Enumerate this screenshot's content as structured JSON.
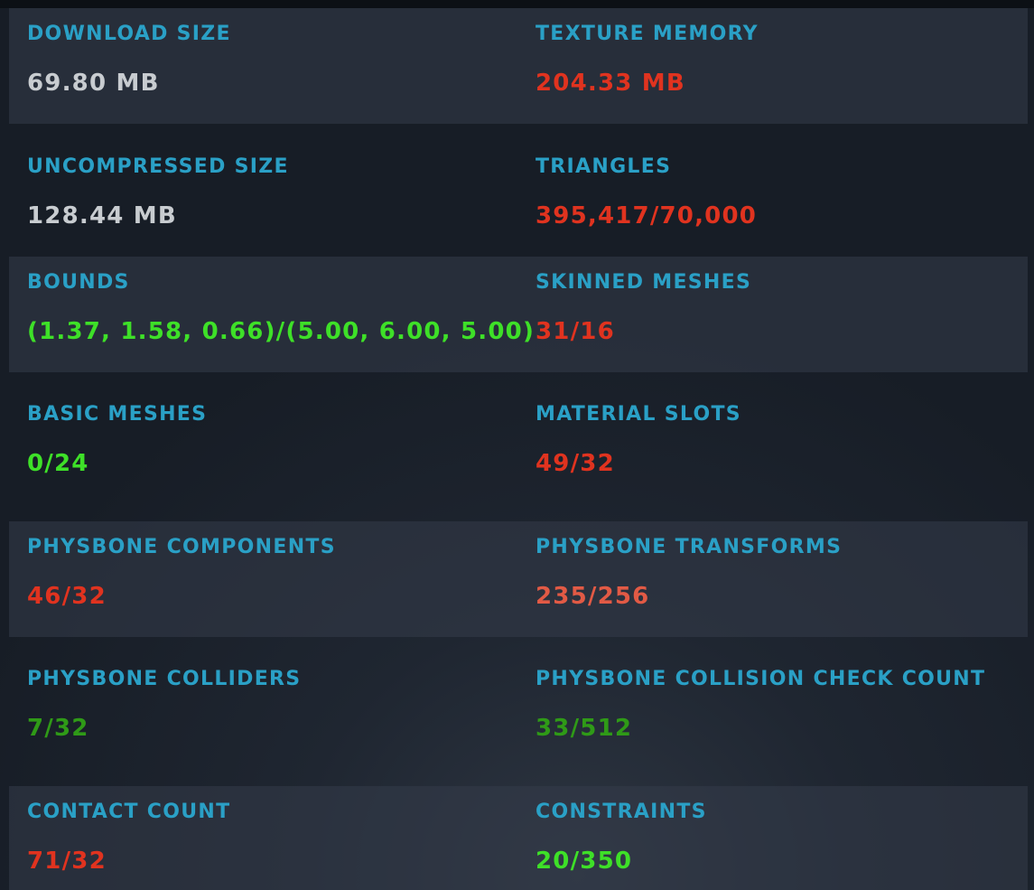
{
  "colors": {
    "label": "#2aa0c6",
    "neutral": "#c8ccd0",
    "bad": "#e0331f",
    "warn": "#e25a45",
    "good": "#3ee028",
    "ok": "#2f9a17"
  },
  "rows": [
    {
      "left": {
        "label": "DOWNLOAD SIZE",
        "value": "69.80 MB",
        "status": "neutral"
      },
      "right": {
        "label": "TEXTURE MEMORY",
        "value": "204.33 MB",
        "status": "bad"
      }
    },
    {
      "left": {
        "label": "UNCOMPRESSED SIZE",
        "value": "128.44 MB",
        "status": "neutral"
      },
      "right": {
        "label": "TRIANGLES",
        "value": "395,417/70,000",
        "status": "bad"
      }
    },
    {
      "left": {
        "label": "BOUNDS",
        "value": "(1.37, 1.58, 0.66)/(5.00, 6.00, 5.00)",
        "status": "good"
      },
      "right": {
        "label": "SKINNED MESHES",
        "value": "31/16",
        "status": "bad"
      }
    },
    {
      "left": {
        "label": "BASIC MESHES",
        "value": "0/24",
        "status": "good"
      },
      "right": {
        "label": "MATERIAL SLOTS",
        "value": "49/32",
        "status": "bad"
      }
    },
    {
      "left": {
        "label": "PHYSBONE COMPONENTS",
        "value": "46/32",
        "status": "bad"
      },
      "right": {
        "label": "PHYSBONE TRANSFORMS",
        "value": "235/256",
        "status": "warn"
      }
    },
    {
      "left": {
        "label": "PHYSBONE COLLIDERS",
        "value": "7/32",
        "status": "ok"
      },
      "right": {
        "label": "PHYSBONE COLLISION CHECK COUNT",
        "value": "33/512",
        "status": "ok"
      }
    },
    {
      "left": {
        "label": "CONTACT COUNT",
        "value": "71/32",
        "status": "bad"
      },
      "right": {
        "label": "CONSTRAINTS",
        "value": "20/350",
        "status": "good"
      }
    }
  ]
}
